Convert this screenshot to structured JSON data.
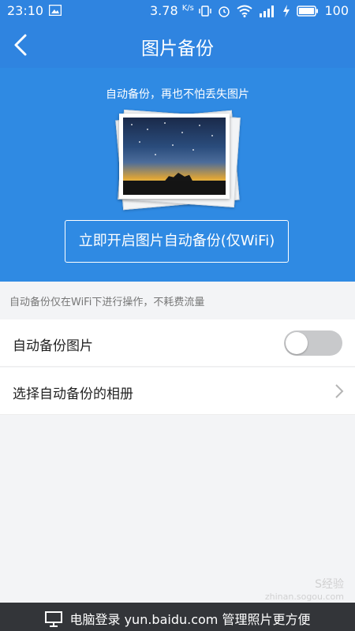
{
  "status_bar": {
    "time": "23:10",
    "net_speed": "3.78",
    "net_speed_unit": "K/s",
    "battery": "100"
  },
  "header": {
    "title": "图片备份"
  },
  "hero": {
    "caption": "自动备份，再也不怕丢失图片",
    "button_label": "立即开启图片自动备份(仅WiFi)"
  },
  "note": "自动备份仅在WiFi下进行操作，不耗费流量",
  "settings": {
    "auto_backup_label": "自动备份图片",
    "auto_backup_on": false,
    "select_album_label": "选择自动备份的相册"
  },
  "footer": {
    "text": "电脑登录 yun.baidu.com 管理照片更方便"
  },
  "watermark": {
    "line1": "S经验",
    "line2": "zhinan.sogou.com"
  },
  "colors": {
    "primary": "#2f84e0",
    "hero_bg": "#2f8ae3",
    "footer_bg": "#333539",
    "toggle_off": "#c8c9cb"
  },
  "icons": [
    "back-arrow-icon",
    "wifi-icon",
    "signal-icon",
    "battery-icon",
    "alarm-icon",
    "vibrate-icon",
    "image-notification-icon",
    "monitor-icon",
    "chevron-right-icon"
  ]
}
